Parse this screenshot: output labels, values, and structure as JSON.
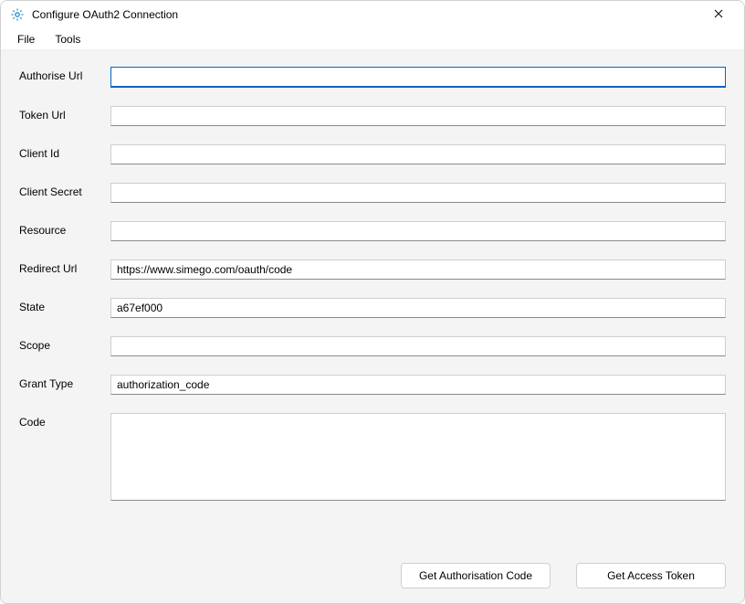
{
  "window": {
    "title": "Configure OAuth2 Connection"
  },
  "menu": {
    "file": "File",
    "tools": "Tools"
  },
  "labels": {
    "authorise_url": "Authorise Url",
    "token_url": "Token Url",
    "client_id": "Client Id",
    "client_secret": "Client Secret",
    "resource": "Resource",
    "redirect_url": "Redirect Url",
    "state": "State",
    "scope": "Scope",
    "grant_type": "Grant Type",
    "code": "Code"
  },
  "values": {
    "authorise_url": "",
    "token_url": "",
    "client_id": "",
    "client_secret": "",
    "resource": "",
    "redirect_url": "https://www.simego.com/oauth/code",
    "state": "a67ef000",
    "scope": "",
    "grant_type": "authorization_code",
    "code": ""
  },
  "buttons": {
    "get_auth_code": "Get Authorisation Code",
    "get_access_token": "Get Access Token"
  }
}
